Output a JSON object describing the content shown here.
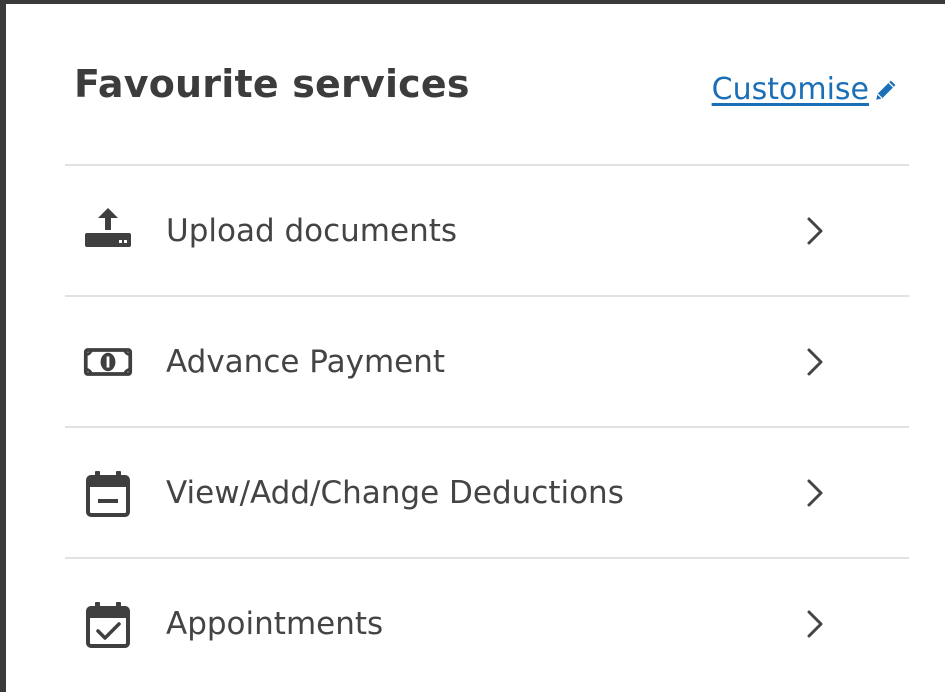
{
  "panel": {
    "title": "Favourite services",
    "customise_label": "Customise"
  },
  "services": [
    {
      "label": "Upload documents",
      "icon": "upload-icon"
    },
    {
      "label": "Advance Payment",
      "icon": "money-icon"
    },
    {
      "label": "View/Add/Change Deductions",
      "icon": "calendar-minus-icon"
    },
    {
      "label": "Appointments",
      "icon": "calendar-check-icon"
    }
  ],
  "colors": {
    "link": "#1a6fb7",
    "text": "#444444",
    "title": "#3c3c3c",
    "divider": "#e2e2e2"
  }
}
